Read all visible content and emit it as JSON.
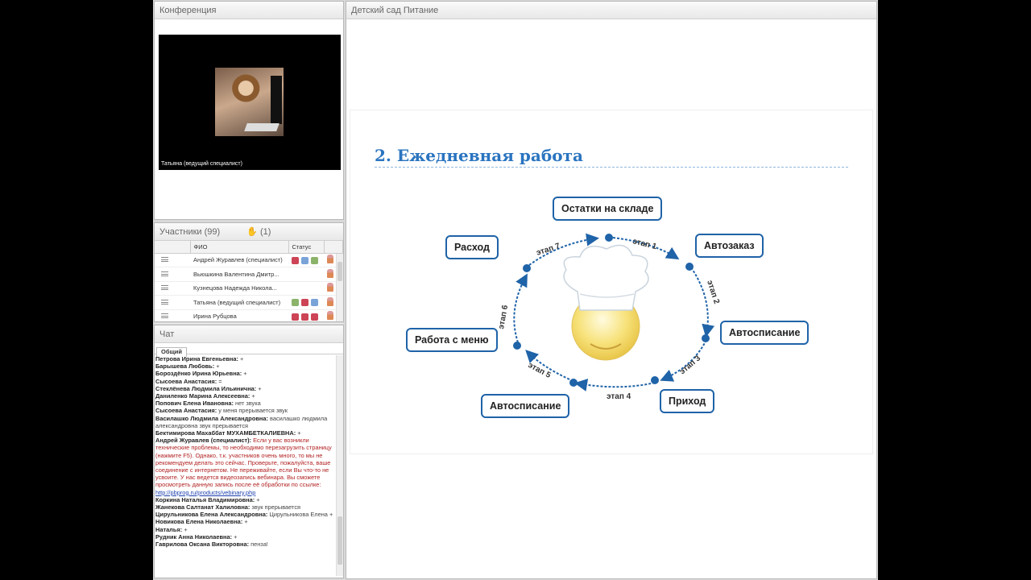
{
  "conference": {
    "title": "Конференция",
    "video_label": "Татьяна (ведущий специалист)"
  },
  "participants": {
    "title": "Участники (99)",
    "raised_hands": "(1)",
    "columns": [
      "ФИО",
      "Статус"
    ],
    "rows": [
      {
        "name": "Андрей Журавлев (специалист)"
      },
      {
        "name": "Вьюшкина Валентина Дмитр..."
      },
      {
        "name": "Кузнецова Надежда  Никола..."
      },
      {
        "name": "Татьяна (ведущий специалист)"
      },
      {
        "name": "Ирина Рубцова"
      }
    ]
  },
  "chat": {
    "title": "Чат",
    "tab": "Общий",
    "messages": [
      {
        "name": "Петрова  Ирина  Евгеньевна:",
        "text": "+"
      },
      {
        "name": "Барышева Любовь:",
        "text": "+"
      },
      {
        "name": "Бороздёнко Ирина  Юрьевна:",
        "text": "+"
      },
      {
        "name": "Сысоева Анастасия:",
        "text": "="
      },
      {
        "name": "Стеклёнева Людмила  Ильинична:",
        "text": "+"
      },
      {
        "name": "Даниленко Марина  Алексеевна:",
        "text": "+"
      },
      {
        "name": "Попович Елена  Ивановна:",
        "text": "нет звука"
      },
      {
        "name": "Сысоева Анастасия:",
        "text": "у меня прерывается звук"
      },
      {
        "name": "Василашко Людмила Александровна:",
        "text": "василашко людмила  александровна звук прерывается"
      },
      {
        "name": "Бектимирова Махаббат МУХАМБЕТКАЛИЕВНА:",
        "text": "+"
      },
      {
        "name": "Андрей Журавлев (специалист):",
        "text": "Если у вас возникли технические проблемы, то необходимо перезагрузить страницу (нажмите F5). Однако, т.к. участников очень много, то мы не рекомендуем делать это сейчас. Проверьте, пожалуйста, ваше соединение с интернетом. Не переживайте, если Вы что-то не усвоите. У нас ведется видеозапись вебинара. Вы сможете  просмотреть данную запись после её обработки  по ссылке:",
        "link": "http://pbprog.ru/products/vebinary.php",
        "red": true
      },
      {
        "name": "Коркина Наталья  Владимировна:",
        "text": "+"
      },
      {
        "name": "Жанекова  Салтанат  Халиловна:",
        "text": "звук прерывается"
      },
      {
        "name": "Цирульникова Елена  Александровна:",
        "text": "Цирульникова Елена +"
      },
      {
        "name": "Новикова Елена  Николаевна:",
        "text": "+"
      },
      {
        "name": "Наталья:",
        "text": "+"
      },
      {
        "name": "Рудник Анна  Николаевна:",
        "text": "+"
      },
      {
        "name": "Гаврилова  Оксана Викторовна:",
        "text": "пенза!"
      }
    ]
  },
  "presentation": {
    "title": "Детский сад Питание",
    "slide_title": "2. Ежедневная работа",
    "nodes": [
      "Остатки на складе",
      "Автозаказ",
      "Автосписание",
      "Приход",
      "Автосписание",
      "Работа с меню",
      "Расход"
    ],
    "stages": [
      "этап 1",
      "этап 2",
      "этап 3",
      "этап 4",
      "этап 5",
      "этап 6",
      "этап 7"
    ]
  },
  "colors": {
    "accent": "#1f63a8",
    "title": "#2a74c0",
    "alert": "#b22222"
  }
}
